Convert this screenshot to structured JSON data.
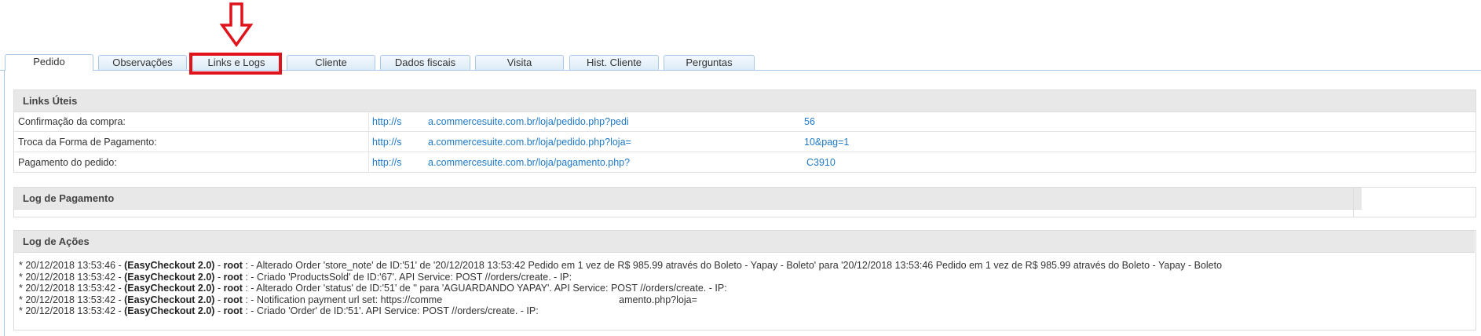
{
  "tabs": [
    {
      "label": "Pedido",
      "active": true
    },
    {
      "label": "Observações"
    },
    {
      "label": "Links e Logs"
    },
    {
      "label": "Cliente"
    },
    {
      "label": "Dados fiscais"
    },
    {
      "label": "Visita"
    },
    {
      "label": "Hist. Cliente"
    },
    {
      "label": "Perguntas"
    }
  ],
  "links_uteis": {
    "title": "Links Úteis",
    "rows": [
      {
        "label": "Confirmação da compra:",
        "url_start": "http://s",
        "url_mid": "a.commercesuite.com.br/loja/pedido.php?pedi",
        "url_end": "56"
      },
      {
        "label": "Troca da Forma de Pagamento:",
        "url_start": "http://s",
        "url_mid": "a.commercesuite.com.br/loja/pedido.php?loja=",
        "url_end": "10&pag=1"
      },
      {
        "label": "Pagamento do pedido:",
        "url_start": "http://s",
        "url_mid": "a.commercesuite.com.br/loja/pagamento.php?",
        "url_end": "C3910"
      }
    ]
  },
  "log_pagamento": {
    "title": "Log de Pagamento"
  },
  "log_acoes": {
    "title": "Log de Ações",
    "lines": [
      {
        "prefix": "* 20/12/2018 13:53:46 - ",
        "app": "(EasyCheckout 2.0)",
        "sep": " - ",
        "user": "root",
        "text": " : - Alterado Order 'store_note' de ID:'51' de '20/12/2018 13:53:42 Pedido em 1 vez de R$ 985.99 através do Boleto - Yapay - Boleto' para '20/12/2018 13:53:46 Pedido em 1 vez de R$ 985.99 através do Boleto - Yapay - Boleto"
      },
      {
        "prefix": "* 20/12/2018 13:53:42 - ",
        "app": "(EasyCheckout 2.0)",
        "sep": " - ",
        "user": "root",
        "text": " : - Criado 'ProductsSold' de ID:'67'. API Service: POST //orders/create. - IP:"
      },
      {
        "prefix": "* 20/12/2018 13:53:42 - ",
        "app": "(EasyCheckout 2.0)",
        "sep": " - ",
        "user": "root",
        "text": " : - Alterado Order 'status' de ID:'51' de '' para 'AGUARDANDO YAPAY'. API Service: POST //orders/create. - IP:"
      },
      {
        "prefix": "* 20/12/2018 13:53:42 - ",
        "app": "(EasyCheckout 2.0)",
        "sep": " - ",
        "user": "root",
        "text": " : - Notification payment url set: https://comme",
        "tail": "amento.php?loja="
      },
      {
        "prefix": "* 20/12/2018 13:53:42 - ",
        "app": "(EasyCheckout 2.0)",
        "sep": " - ",
        "user": "root",
        "text": " : - Criado 'Order' de ID:'51'. API Service: POST //orders/create. - IP:"
      }
    ]
  },
  "annotation": {
    "arrow_color": "#e0121b",
    "highlight_color": "#e0121b"
  }
}
